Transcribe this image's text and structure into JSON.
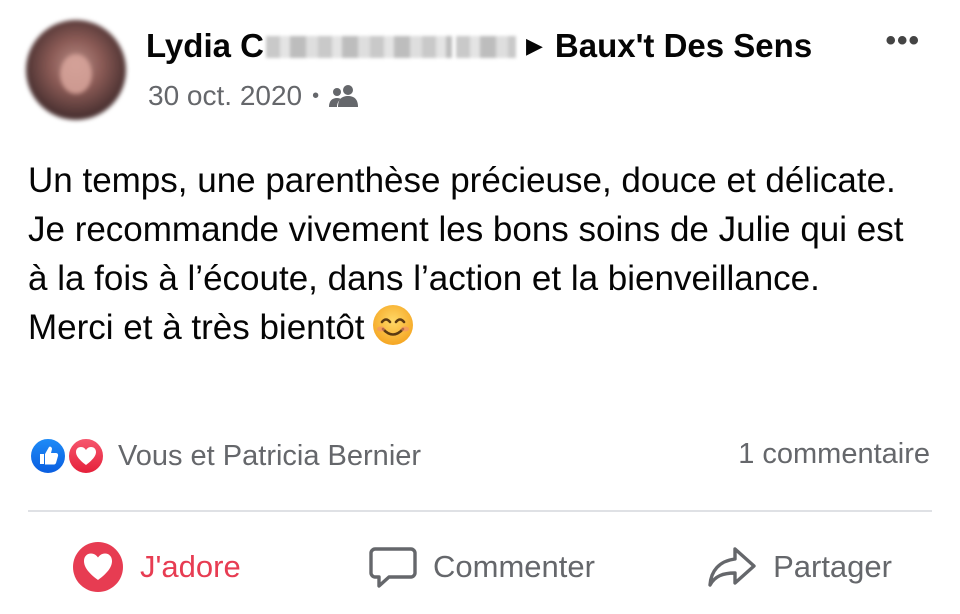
{
  "post": {
    "author": "Lydia C",
    "separator": "▶",
    "page_name": "Baux't Des Sens",
    "date": "30 oct. 2020",
    "meta_dot": "•",
    "more_menu": "•••",
    "audience_icon": "friends-icon",
    "body": [
      "Un temps, une parenthèse précieuse, douce et délicate. Je recommande vivement les bons soins de Julie qui est à la fois à l’écoute, dans l’action et la bienveillance.",
      "Merci et à très bientôt"
    ],
    "emoji": "smiling-face-emoji"
  },
  "reactions": {
    "names": "Vous et Patricia Bernier",
    "comment_count": "1 commentaire",
    "icons": [
      "like-icon",
      "love-icon"
    ]
  },
  "actions": {
    "adore_label": "J'adore",
    "comment_label": "Commenter",
    "share_label": "Partager"
  },
  "colors": {
    "adore": "#e73c52",
    "like_blue": "#1877f2",
    "secondary_text": "#65676b"
  }
}
